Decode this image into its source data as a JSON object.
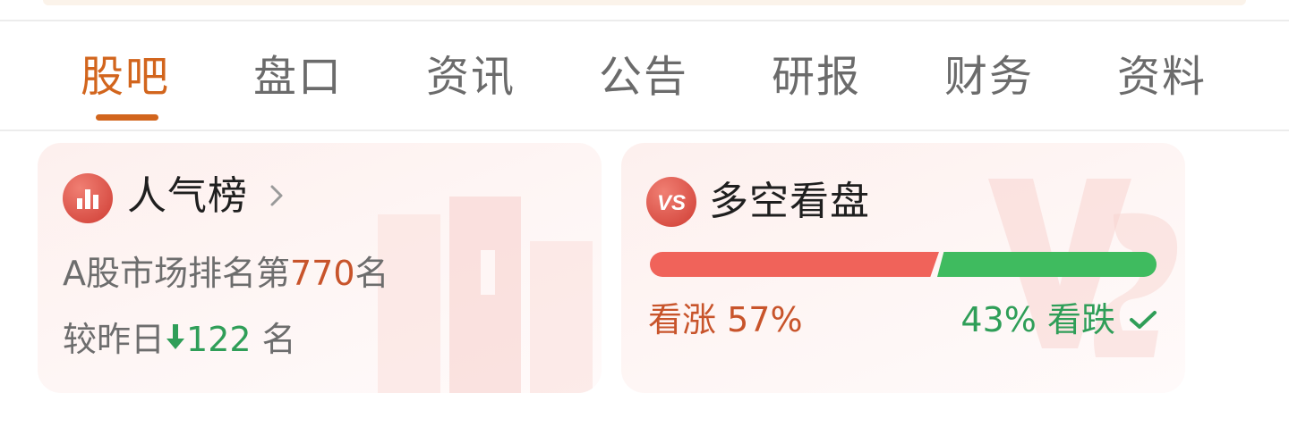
{
  "tabs": [
    {
      "label": "股吧",
      "active": true
    },
    {
      "label": "盘口",
      "active": false
    },
    {
      "label": "资讯",
      "active": false
    },
    {
      "label": "公告",
      "active": false
    },
    {
      "label": "研报",
      "active": false
    },
    {
      "label": "财务",
      "active": false
    },
    {
      "label": "资料",
      "active": false
    }
  ],
  "popularity": {
    "icon": "bar-chart-icon",
    "title": "人气榜",
    "rank_prefix": "A股市场排名第",
    "rank_value": "770",
    "rank_suffix": "名",
    "change_prefix": "较昨日",
    "change_icon": "arrow-down-icon",
    "change_value": "122",
    "change_suffix": "名"
  },
  "sentiment": {
    "icon": "vs-icon",
    "title": "多空看盘",
    "bull_label": "看涨",
    "bull_percent": "57%",
    "bull_fraction": 0.57,
    "bear_label": "看跌",
    "bear_percent": "43%",
    "bear_fraction": 0.43,
    "selected_icon": "checkmark-icon"
  },
  "colors": {
    "accent": "#d2651d",
    "bull": "#f0635a",
    "bear": "#3fbb5f",
    "bull_text": "#c8542b",
    "bear_text": "#2f9e58"
  }
}
